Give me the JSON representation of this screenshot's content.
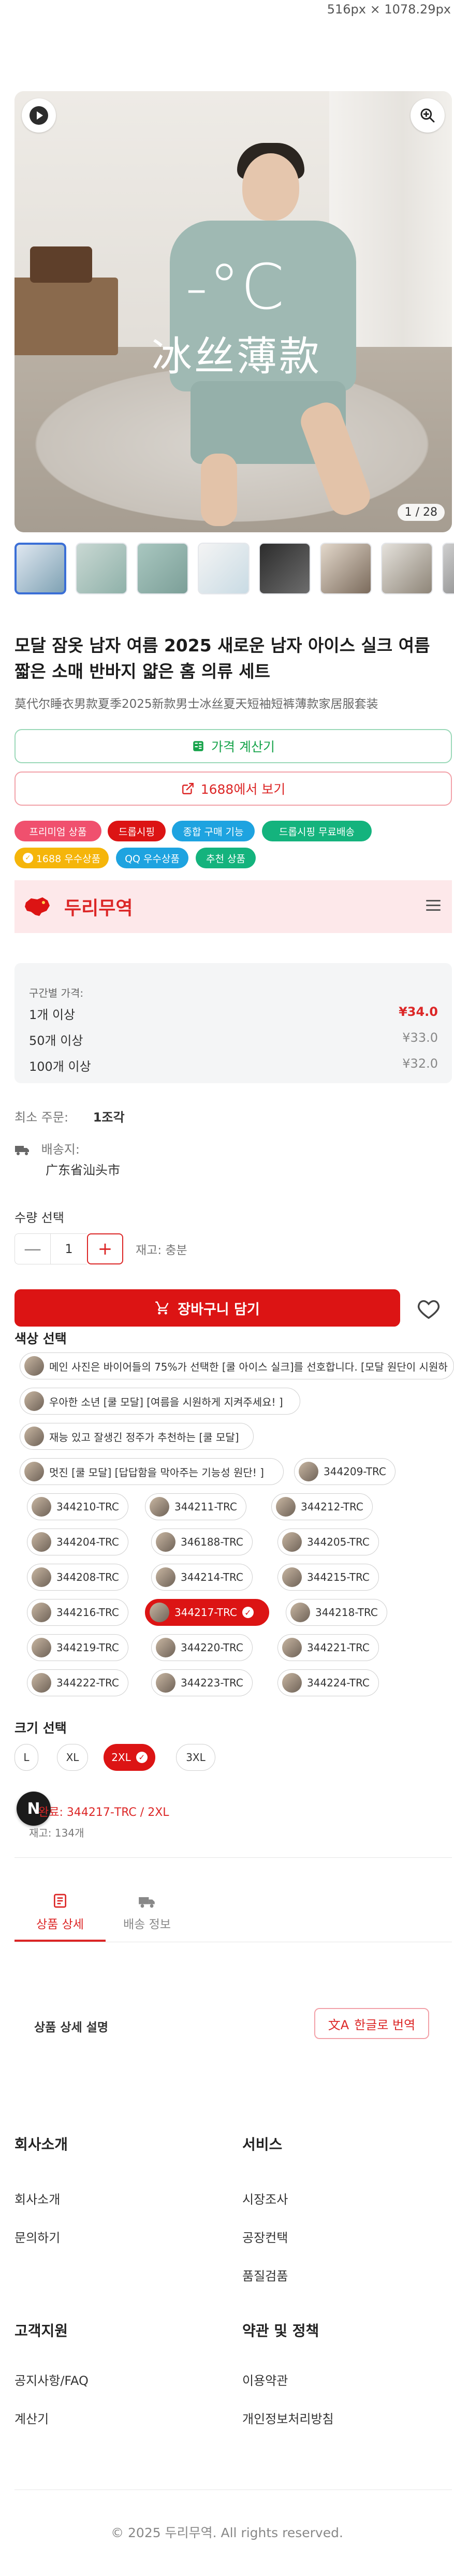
{
  "viewport_note": "516px × 1078.29px",
  "gallery": {
    "counter": "1 / 28",
    "overlay_temp": "-°C",
    "overlay_caption": "冰丝薄款",
    "thumbnail_count": 8
  },
  "product": {
    "title": "모달 잠옷 남자 여름 2025 새로운 남자 아이스 실크 여름 짧은 소매 반바지 얇은 홈 의류 세트",
    "subtitle": "莫代尔睡衣男款夏季2025新款男士冰丝夏天短袖短裤薄款家居服套装"
  },
  "actions": {
    "price_calc": "가격 계산기",
    "view_1688": "1688에서 보기"
  },
  "badges": [
    {
      "label": "프리미엄 상품",
      "color": "#f0506e"
    },
    {
      "label": "드롭시핑",
      "color": "#dc1414"
    },
    {
      "label": "종합 구매 기능",
      "color": "#1ea3e0"
    },
    {
      "label": "드롭시핑 무료배송",
      "color": "#14b37d"
    },
    {
      "label": "1688 우수상품",
      "color": "#f5b50a"
    },
    {
      "label": "QQ 우수상품",
      "color": "#1ea3e0"
    },
    {
      "label": "추천 상품",
      "color": "#14b37d"
    }
  ],
  "brand": {
    "name": "두리무역",
    "accent": "#dc1414"
  },
  "pricing": {
    "label": "구간별 가격:",
    "tiers": [
      {
        "qty": "1개 이상",
        "price": "¥34.0"
      },
      {
        "qty": "50개 이상",
        "price": "¥33.0"
      },
      {
        "qty": "100개 이상",
        "price": "¥32.0"
      }
    ]
  },
  "order": {
    "min_label": "최소 주문:",
    "min_value": "1조각",
    "ship_label": "배송지:",
    "ship_value": "广东省汕头市"
  },
  "quantity": {
    "label": "수량 선택",
    "minus": "—",
    "value": "1",
    "plus": "+",
    "stock": "재고: 충분"
  },
  "cart": {
    "label": "장바구니 담기"
  },
  "colors": {
    "label": "색상 선택",
    "options": [
      "메인 사진은 바이어들의 75%가 선택한 [쿨 아이스 실크]를 선호합니다. [모달 원단이 시원하",
      "우아한 소년 [쿨 모달] [여름을 시원하게 지켜주세요! ]",
      "재능 있고 잘생긴 정주가 추천하는 [쿨 모달]",
      "멋진 [쿨 모달] [답답함을 막아주는 기능성 원단! ]",
      "344209-TRC",
      "344210-TRC",
      "344211-TRC",
      "344212-TRC",
      "344204-TRC",
      "346188-TRC",
      "344205-TRC",
      "344208-TRC",
      "344214-TRC",
      "344215-TRC",
      "344216-TRC",
      "344217-TRC",
      "344218-TRC",
      "344219-TRC",
      "344220-TRC",
      "344221-TRC",
      "344222-TRC",
      "344223-TRC",
      "344224-TRC"
    ],
    "selected": "344217-TRC"
  },
  "sizes": {
    "label": "크기 선택",
    "options": [
      "L",
      "XL",
      "2XL",
      "3XL"
    ],
    "selected": "2XL"
  },
  "selection_summary": {
    "text": "완료: 344217-TRC / 2XL",
    "stock": "재고: 134개",
    "avatar_letter": "N"
  },
  "tabs": [
    {
      "label": "상품 상세",
      "icon": "document-icon"
    },
    {
      "label": "배송 정보",
      "icon": "truck-icon"
    }
  ],
  "detail": {
    "title": "상품 상세 설명",
    "translate": "한글로 번역"
  },
  "footer": {
    "company": {
      "title": "회사소개",
      "links": [
        "회사소개",
        "문의하기"
      ]
    },
    "services": {
      "title": "서비스",
      "links": [
        "시장조사",
        "공장컨택",
        "품질검품"
      ]
    },
    "support": {
      "title": "고객지원",
      "links": [
        "공지사항/FAQ",
        "계산기"
      ]
    },
    "policy": {
      "title": "약관 및 정책",
      "links": [
        "이용약관",
        "개인정보처리방침"
      ]
    },
    "copyright": "© 2025 두리무역. All rights reserved."
  }
}
